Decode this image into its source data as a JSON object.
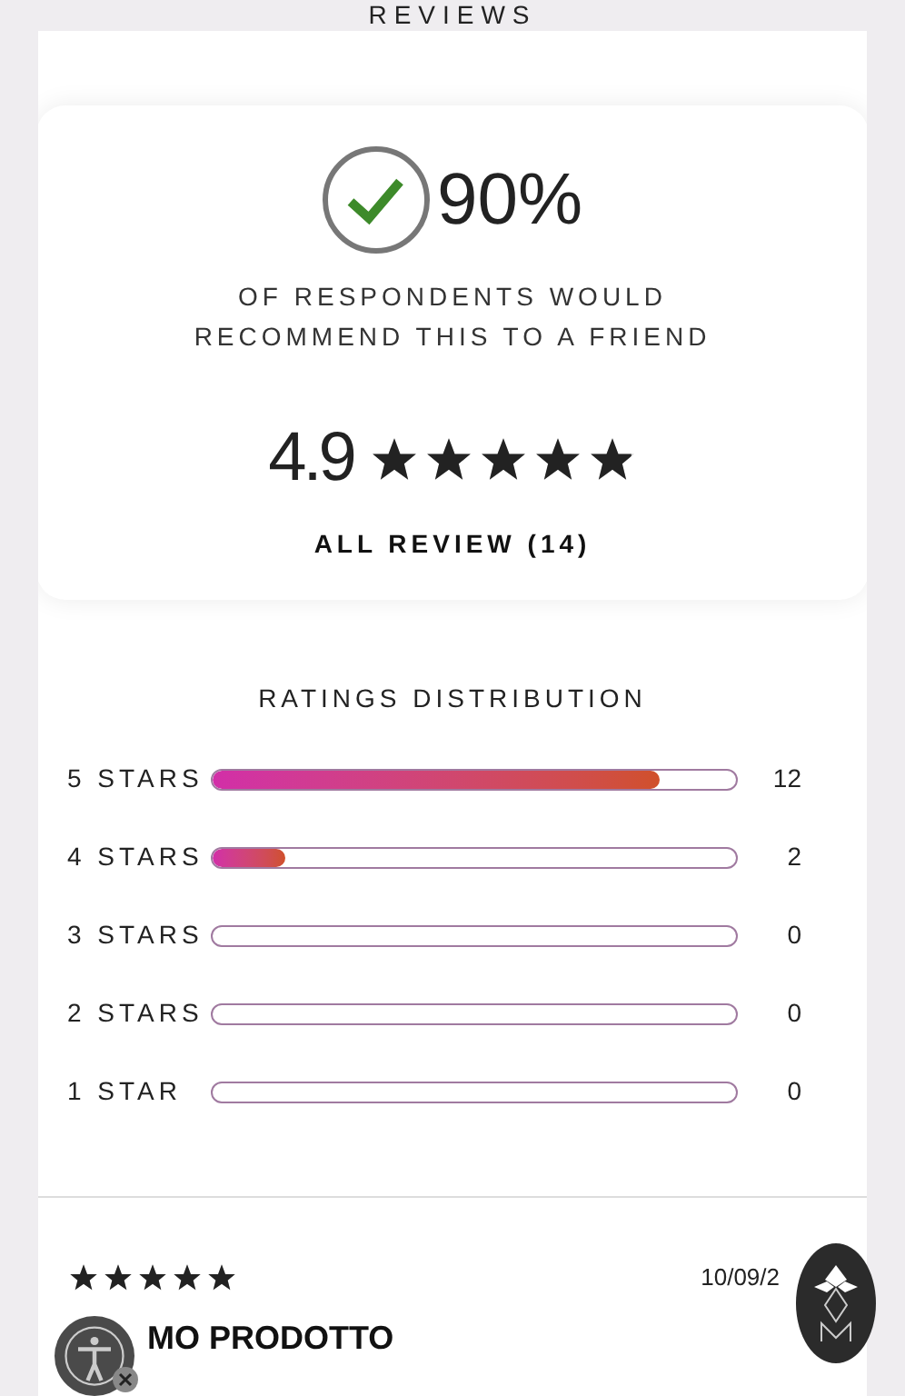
{
  "section_title": "REVIEWS",
  "summary": {
    "percent": "90%",
    "recommend_text": "OF RESPONDENTS WOULD RECOMMEND THIS TO A FRIEND",
    "average": "4.9",
    "stars": 4.9,
    "all_reviews_link": "ALL REVIEW (14)"
  },
  "distribution": {
    "title": "RATINGS DISTRIBUTION",
    "rows": [
      {
        "label": "5 STARS",
        "level": 0.855,
        "count": "12"
      },
      {
        "label": "4 STARS",
        "level": 0.14,
        "count": "2"
      },
      {
        "label": "3 STARS",
        "level": 0,
        "count": "0"
      },
      {
        "label": "2 STARS",
        "level": 0,
        "count": "0"
      },
      {
        "label": "1 STAR",
        "level": 0,
        "count": "0"
      }
    ]
  },
  "review": {
    "stars": 5,
    "date": "10/09/2",
    "title": "MO PRODOTTO"
  }
}
